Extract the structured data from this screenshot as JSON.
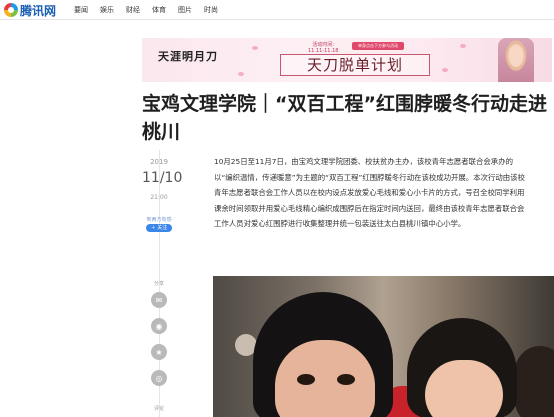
{
  "site": {
    "logo_text": "腾讯网",
    "nav": [
      "要闻",
      "娱乐",
      "财经",
      "体育",
      "图片",
      "时尚"
    ]
  },
  "banner": {
    "calligraphy": "天涯明月刀",
    "time_label": "活动时间:",
    "time_value": "11.11-11.18",
    "badge": "单身点击下方参与活动",
    "title": "天刀脱单计划"
  },
  "article": {
    "title": "宝鸡文理学院｜“双百工程”红围脖暖冬行动走进桃川",
    "date_year": "2019",
    "date_md": "11/10",
    "time": "21:00",
    "source": "到两方有感",
    "follow_label": "＋ 关注",
    "body": "10月25日至11月7日，由宝鸡文理学院团委、校扶贫办主办，该校青年志愿者联合会承办的以“编织温情，传递暖意”为主题的“双百工程”红围脖暖冬行动在该校成功开展。本次行动由该校青年志愿者联合会工作人员以在校内设点发放爱心毛线和爱心小卡片的方式，号召全校同学利用课余时间领取并用爱心毛线精心编织成围脖后在指定时间内送回，最终由该校青年志愿者联合会工作人员对爱心红围脖进行收集整理并统一包装送往太白县桃川镇中心小学。"
  },
  "sidebar": {
    "share_label": "分享",
    "share_buttons": [
      {
        "icon": "qq-icon",
        "glyph": "◉"
      },
      {
        "icon": "qzone-icon",
        "glyph": "★"
      },
      {
        "icon": "weibo-icon",
        "glyph": "◎"
      }
    ],
    "comment_label": "评论"
  }
}
